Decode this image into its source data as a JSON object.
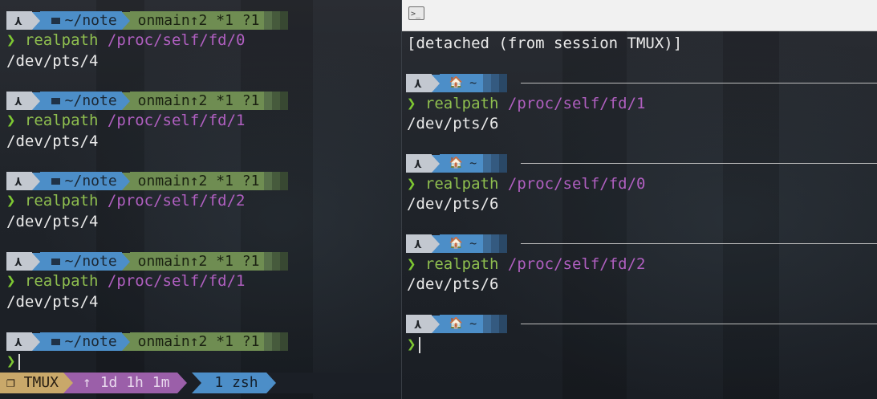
{
  "left_pane": {
    "prompt": {
      "arch_symbol": "⋏",
      "dir": "~/note",
      "git_prefix": "on",
      "git_icon": "",
      "branch_icon": "",
      "branch": "main",
      "status": "↑2 *1 ?1"
    },
    "blocks": [
      {
        "command": "realpath",
        "arg": "/proc/self/fd/0",
        "output": "/dev/pts/4"
      },
      {
        "command": "realpath",
        "arg": "/proc/self/fd/1",
        "output": "/dev/pts/4"
      },
      {
        "command": "realpath",
        "arg": "/proc/self/fd/2",
        "output": "/dev/pts/4"
      },
      {
        "command": "realpath",
        "arg": "/proc/self/fd/1",
        "output": "/dev/pts/4"
      }
    ],
    "prompt_char": "❯"
  },
  "tmux_status": {
    "session": "❐ TMUX",
    "uptime": "↑ 1d 1h 1m",
    "window": "1 zsh"
  },
  "right_pane": {
    "detached_msg": "[detached (from session TMUX)]",
    "prompt": {
      "arch_symbol": "⋏",
      "home_icon": "🏠",
      "dir": "~"
    },
    "blocks": [
      {
        "command": "realpath",
        "arg": "/proc/self/fd/1",
        "output": "/dev/pts/6"
      },
      {
        "command": "realpath",
        "arg": "/proc/self/fd/0",
        "output": "/dev/pts/6"
      },
      {
        "command": "realpath",
        "arg": "/proc/self/fd/2",
        "output": "/dev/pts/6"
      }
    ],
    "prompt_char": "❯"
  },
  "colors": {
    "prompt_arch": "#c3c8d0",
    "prompt_dir": "#4c8ec8",
    "prompt_git": "#6f8d52",
    "command": "#8fbf4f",
    "argument": "#b05fc0",
    "tmux_session": "#c9a86a",
    "tmux_uptime": "#9b5fa9",
    "tmux_window": "#4c8ec8"
  }
}
